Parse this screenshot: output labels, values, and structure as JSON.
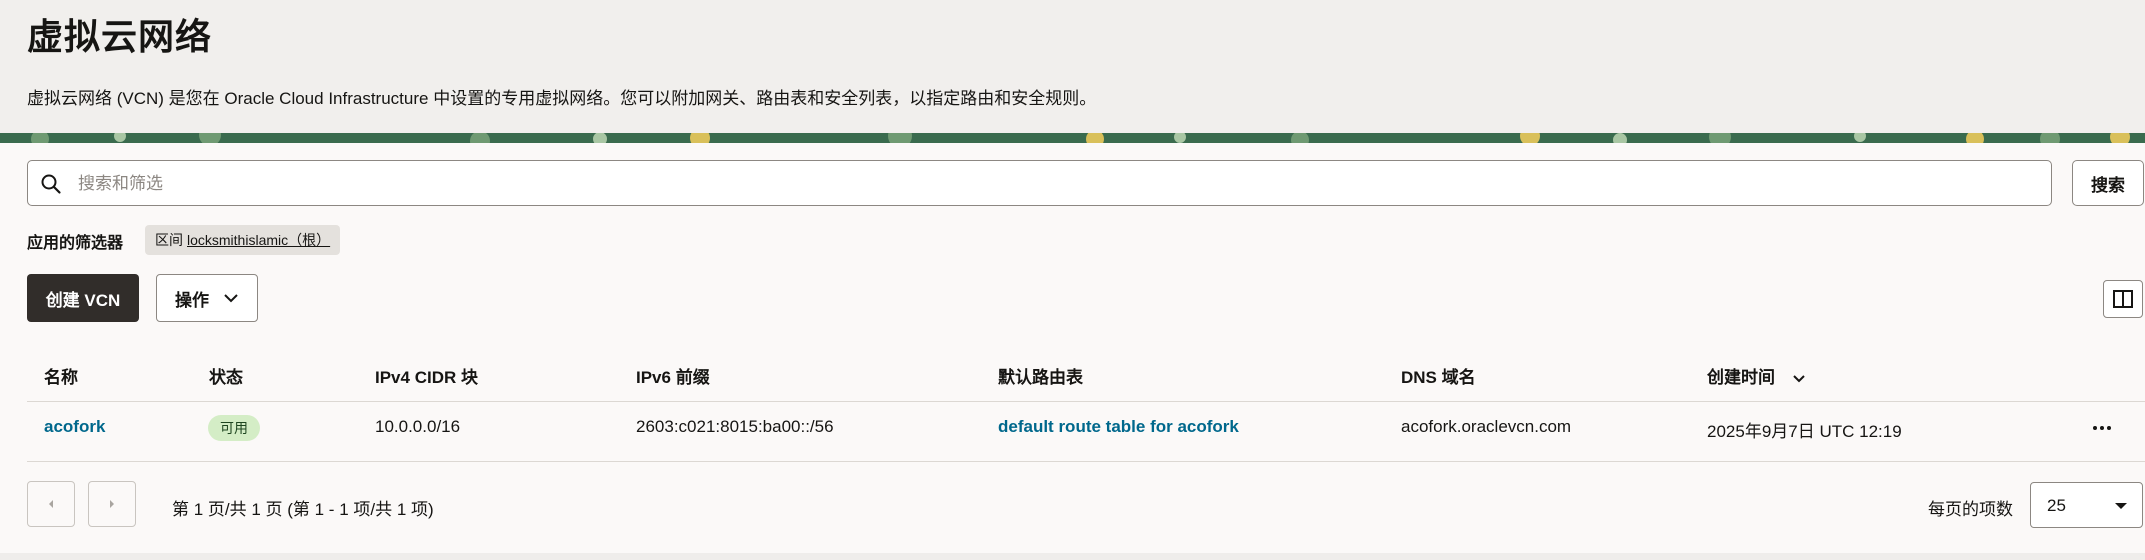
{
  "page": {
    "title": "虚拟云网络",
    "description": "虚拟云网络 (VCN) 是您在 Oracle Cloud Infrastructure 中设置的专用虚拟网络。您可以附加网关、路由表和安全列表，以指定路由和安全规则。"
  },
  "search": {
    "placeholder": "搜索和筛选",
    "button_label": "搜索"
  },
  "filters": {
    "label": "应用的筛选器",
    "chips": [
      {
        "name": "区间",
        "value": "locksmithislamic（根）"
      }
    ]
  },
  "toolbar": {
    "create_label": "创建 VCN",
    "actions_label": "操作"
  },
  "table": {
    "columns": [
      "名称",
      "状态",
      "IPv4 CIDR 块",
      "IPv6 前缀",
      "默认路由表",
      "DNS 域名",
      "创建时间"
    ],
    "rows": [
      {
        "name": "acofork",
        "status": "可用",
        "ipv4": "10.0.0.0/16",
        "ipv6": "2603:c021:8015:ba00::/56",
        "route_table": "default route table for acofork",
        "dns": "acofork.oraclevcn.com",
        "created": "2025年9月7日 UTC 12:19"
      }
    ]
  },
  "pagination": {
    "info": "第 1 页/共 1 页 (第 1 - 1 项/共 1 项)",
    "per_page_label": "每页的项数",
    "per_page_value": "25"
  },
  "colors": {
    "link": "#00688c",
    "primary_button": "#312d2a",
    "badge_bg": "#d4edc6",
    "banner": "#3a6b4e"
  },
  "icons": [
    "search-icon",
    "chevron-down-icon",
    "columns-icon",
    "chevron-left-icon",
    "chevron-right-icon",
    "caret-down-icon",
    "more-actions-icon"
  ]
}
